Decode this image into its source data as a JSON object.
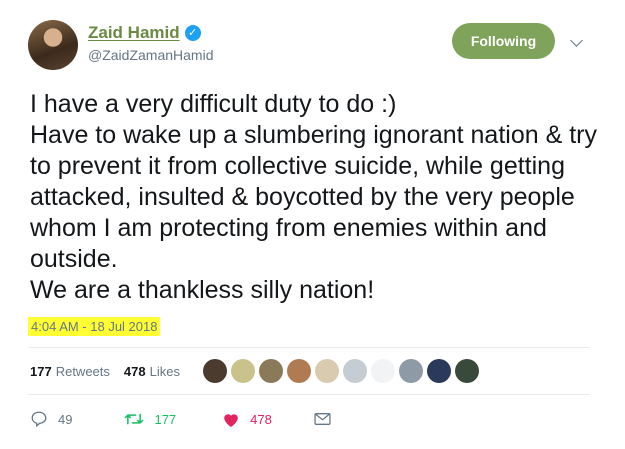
{
  "author": {
    "display_name": "Zaid Hamid",
    "handle": "@ZaidZamanHamid",
    "verified_icon": "✓"
  },
  "follow_button": {
    "label": "Following"
  },
  "tweet": {
    "text": "I have a very difficult duty to do :)\nHave to wake up a slumbering ignorant nation & try to prevent it from collective suicide, while getting attacked, insulted & boycotted by the very people whom I am protecting from enemies within and outside.\nWe are a thankless silly nation!",
    "timestamp": "4:04 AM - 18 Jul 2018"
  },
  "stats": {
    "retweets_count": "177",
    "retweets_label": "Retweets",
    "likes_count": "478",
    "likes_label": "Likes"
  },
  "liker_avatars": [
    {
      "name": "liker-avatar-1",
      "color": "#4a3b2e"
    },
    {
      "name": "liker-avatar-2",
      "color": "#c9c28a"
    },
    {
      "name": "liker-avatar-3",
      "color": "#8a7a5a"
    },
    {
      "name": "liker-avatar-4",
      "color": "#b07b53"
    },
    {
      "name": "liker-avatar-5",
      "color": "#d9cbb0"
    },
    {
      "name": "liker-avatar-6",
      "color": "#c5ccd3"
    },
    {
      "name": "liker-avatar-7",
      "color": "#f1f3f4"
    },
    {
      "name": "liker-avatar-8",
      "color": "#8e9aa6"
    },
    {
      "name": "liker-avatar-9",
      "color": "#2b3a5a"
    },
    {
      "name": "liker-avatar-10",
      "color": "#3a4a3a"
    }
  ],
  "actions": {
    "reply_count": "49",
    "retweet_count": "177",
    "like_count": "478"
  },
  "colors": {
    "name": "#6b8a43",
    "follow_button": "#80a35c",
    "highlight": "#ffff33",
    "retweet": "#17bf63",
    "like": "#e0245e"
  }
}
